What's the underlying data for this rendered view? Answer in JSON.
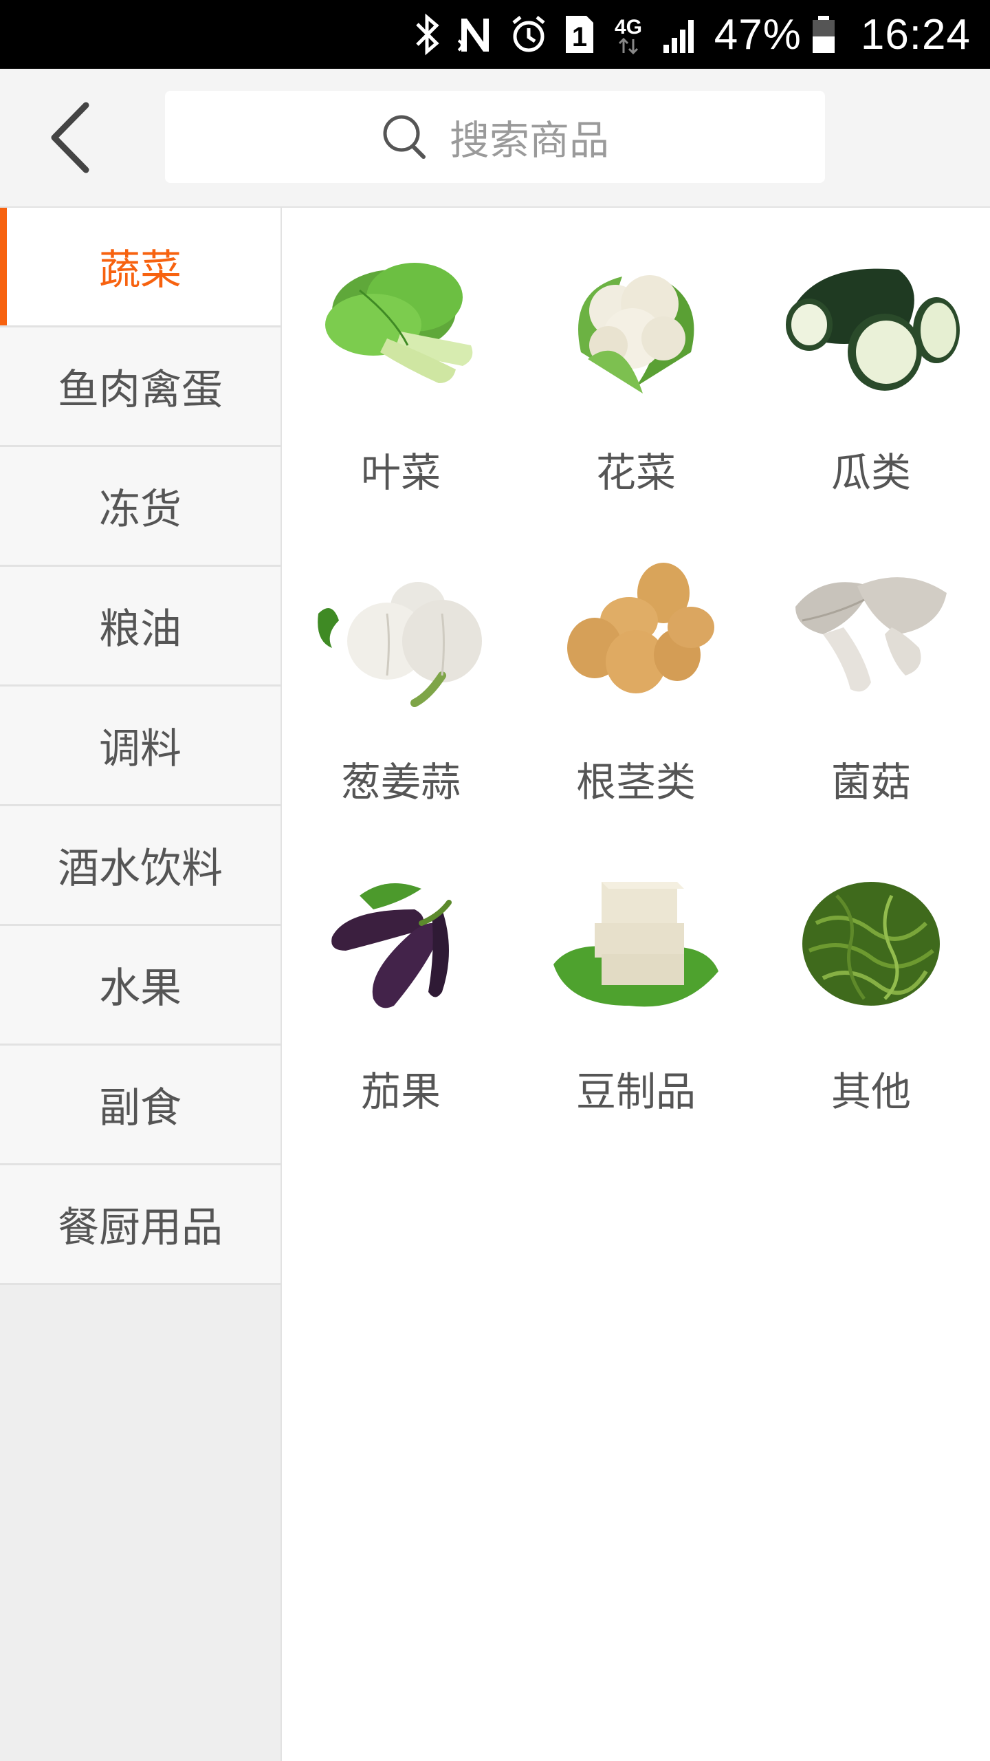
{
  "status_bar": {
    "icons": [
      "bluetooth-icon",
      "nfc-icon",
      "alarm-icon",
      "sim-1-icon",
      "4g-icon",
      "signal-icon",
      "battery-icon"
    ],
    "network": "4G",
    "sim": "1",
    "battery_percent": "47%",
    "time": "16:24"
  },
  "header": {
    "back_icon": "chevron-left-icon",
    "search": {
      "icon": "search-icon",
      "placeholder": "搜索商品"
    }
  },
  "sidebar": {
    "active_color": "#f7620f",
    "items": [
      {
        "label": "蔬菜",
        "active": true
      },
      {
        "label": "鱼肉禽蛋",
        "active": false
      },
      {
        "label": "冻货",
        "active": false
      },
      {
        "label": "粮油",
        "active": false
      },
      {
        "label": "调料",
        "active": false
      },
      {
        "label": "酒水饮料",
        "active": false
      },
      {
        "label": "水果",
        "active": false
      },
      {
        "label": "副食",
        "active": false
      },
      {
        "label": "餐厨用品",
        "active": false
      }
    ]
  },
  "categories": [
    {
      "label": "叶菜",
      "image": "bok-choy-image"
    },
    {
      "label": "花菜",
      "image": "cauliflower-image"
    },
    {
      "label": "瓜类",
      "image": "winter-melon-image"
    },
    {
      "label": "葱姜蒜",
      "image": "garlic-image"
    },
    {
      "label": "根茎类",
      "image": "potato-image"
    },
    {
      "label": "菌菇",
      "image": "mushroom-image"
    },
    {
      "label": "茄果",
      "image": "eggplant-image"
    },
    {
      "label": "豆制品",
      "image": "tofu-image"
    },
    {
      "label": "其他",
      "image": "seaweed-image"
    }
  ]
}
